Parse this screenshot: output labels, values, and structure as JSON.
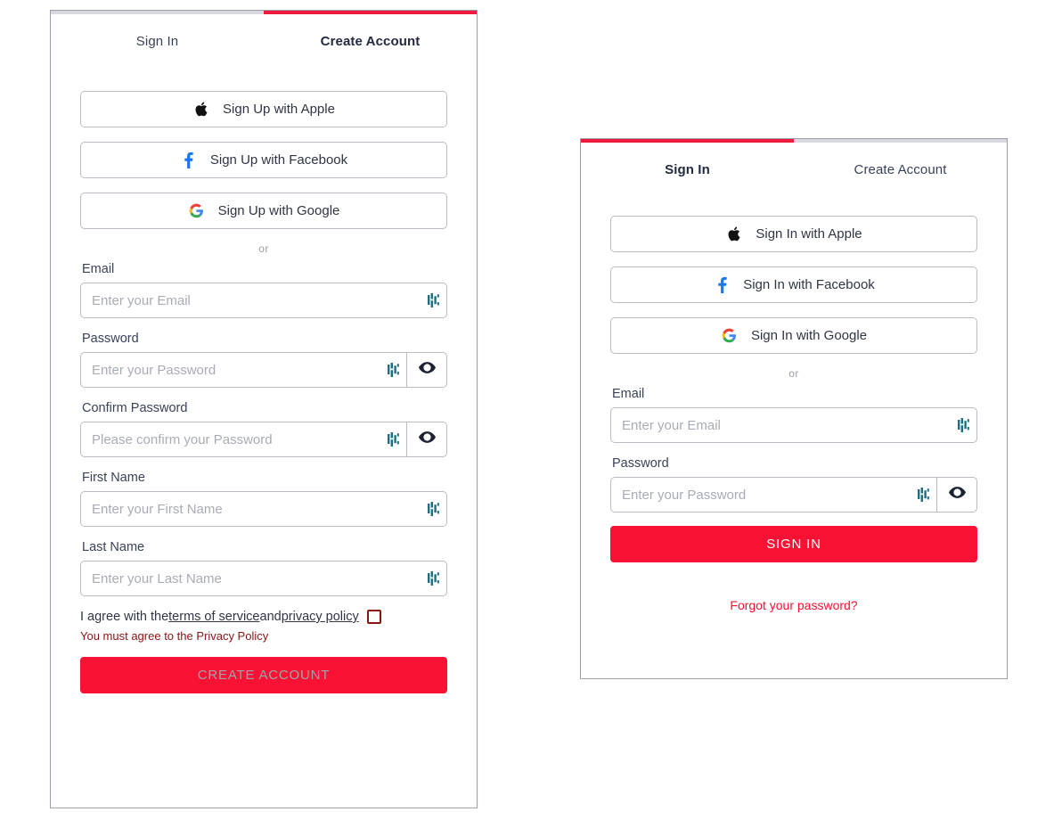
{
  "theme": {
    "accent_red": "#f91233",
    "tab_active_red": "#ef1b3c",
    "tab_inactive_gray": "#d7d9de",
    "label_color": "#3a4258",
    "error_color": "#8b1414",
    "border_gray": "#b9bcc4",
    "placeholder_gray": "#a8acb5",
    "facebook_blue": "#1877f2",
    "apple_black": "#111111",
    "pm_icon_teal": "#1d6e80"
  },
  "signup_card": {
    "tabs": [
      {
        "label": "Sign In",
        "active": false
      },
      {
        "label": "Create Account",
        "active": true
      }
    ],
    "social_buttons": [
      {
        "icon": "apple-icon",
        "label": "Sign Up with Apple"
      },
      {
        "icon": "facebook-icon",
        "label": "Sign Up with Facebook"
      },
      {
        "icon": "google-icon",
        "label": "Sign Up with Google"
      }
    ],
    "divider_text": "or",
    "fields": [
      {
        "label": "Email",
        "placeholder": "Enter your Email",
        "value": "",
        "type": "email",
        "eye": false
      },
      {
        "label": "Password",
        "placeholder": "Enter your Password",
        "value": "",
        "type": "password",
        "eye": true
      },
      {
        "label": "Confirm Password",
        "placeholder": "Please confirm your Password",
        "value": "",
        "type": "password",
        "eye": true
      },
      {
        "label": "First Name",
        "placeholder": "Enter your First Name",
        "value": "",
        "type": "text",
        "eye": false
      },
      {
        "label": "Last Name",
        "placeholder": "Enter your Last Name",
        "value": "",
        "type": "text",
        "eye": false
      }
    ],
    "terms": {
      "prefix": "I agree with the ",
      "terms_link": "terms of service",
      "middle": " and ",
      "privacy_link": "privacy policy",
      "checked": false
    },
    "error_message": "You must agree to the Privacy Policy",
    "submit": {
      "label": "CREATE ACCOUNT",
      "enabled": false
    }
  },
  "signin_card": {
    "tabs": [
      {
        "label": "Sign In",
        "active": true
      },
      {
        "label": "Create Account",
        "active": false
      }
    ],
    "social_buttons": [
      {
        "icon": "apple-icon",
        "label": "Sign In with Apple"
      },
      {
        "icon": "facebook-icon",
        "label": "Sign In with Facebook"
      },
      {
        "icon": "google-icon",
        "label": "Sign In with Google"
      }
    ],
    "divider_text": "or",
    "fields": [
      {
        "label": "Email",
        "placeholder": "Enter your Email",
        "value": "",
        "type": "email",
        "eye": false
      },
      {
        "label": "Password",
        "placeholder": "Enter your Password",
        "value": "",
        "type": "password",
        "eye": true
      }
    ],
    "submit": {
      "label": "SIGN IN",
      "enabled": true
    },
    "forgot_link": "Forgot your password?"
  }
}
